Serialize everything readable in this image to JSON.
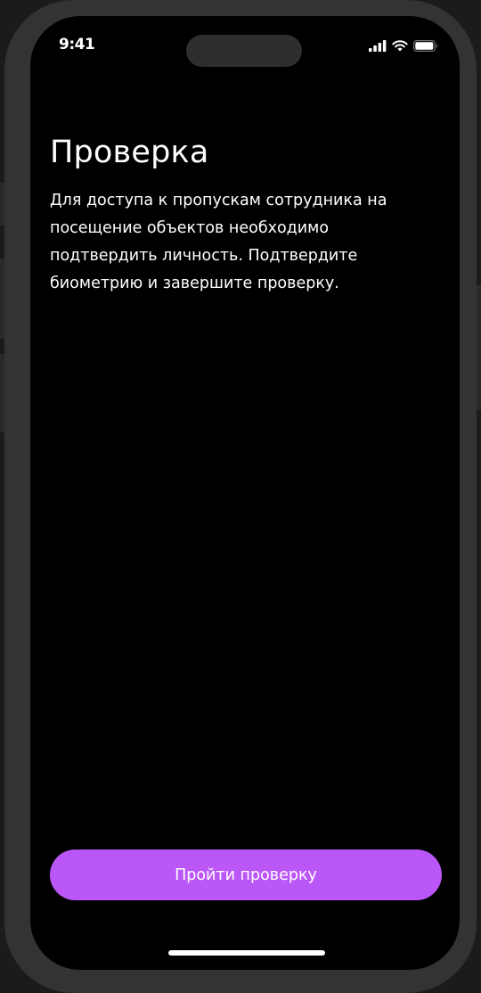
{
  "status_bar": {
    "time": "9:41",
    "icons": [
      "cellular-signal-icon",
      "wifi-icon",
      "battery-icon"
    ]
  },
  "main": {
    "title": "Проверка",
    "description": "Для доступа к пропускам сотрудника на посещение объектов необходимо подтвердить личность. Подтвердите биометрию и завершите проверку."
  },
  "actions": {
    "primary_label": "Пройти проверку"
  },
  "colors": {
    "accent": "#bb56f7",
    "background": "#000000",
    "text": "#ffffff"
  }
}
